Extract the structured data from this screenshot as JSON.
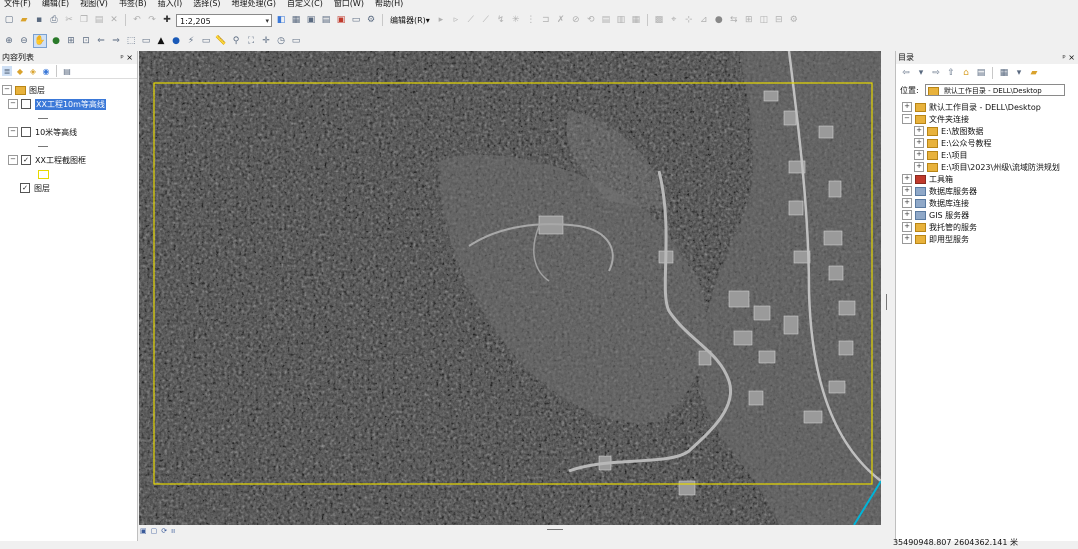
{
  "menus": [
    "文件(F)",
    "编辑(E)",
    "视图(V)",
    "书签(B)",
    "插入(I)",
    "选择(S)",
    "地理处理(G)",
    "自定义(C)",
    "窗口(W)",
    "帮助(H)"
  ],
  "toolbar": {
    "scale_value": "1:2,205",
    "editor_label": "编辑器(R)▾"
  },
  "toc": {
    "title": "内容列表",
    "pin_close": "ᵖ ×",
    "root_label": "图层",
    "layers": [
      {
        "label": "XX工程10m等高线",
        "checked": false,
        "selected": true
      },
      {
        "label": "10米等高线",
        "checked": false,
        "selected": false
      },
      {
        "label": "XX工程截图框",
        "checked": true,
        "selected": false
      }
    ],
    "sublayer_label": "图层",
    "sublayer_checked": true
  },
  "catalog": {
    "title": "目录",
    "pin_close": "ᵖ ×",
    "location_label": "位置:",
    "location_value": "默认工作目录 - DELL\\Desktop",
    "items": [
      {
        "label": "默认工作目录 - DELL\\Desktop",
        "child": false
      },
      {
        "label": "文件夹连接",
        "child": false
      },
      {
        "label": "E:\\放图数据",
        "child": true
      },
      {
        "label": "E:\\公众号教程",
        "child": true
      },
      {
        "label": "E:\\项目",
        "child": true
      },
      {
        "label": "E:\\项目\\2023\\州级\\流域防洪规划",
        "child": true
      },
      {
        "label": "工具箱",
        "child": false
      },
      {
        "label": "数据库服务器",
        "child": false
      },
      {
        "label": "数据库连接",
        "child": false
      },
      {
        "label": "GIS 服务器",
        "child": false
      },
      {
        "label": "我托管的服务",
        "child": false
      },
      {
        "label": "即用型服务",
        "child": false
      }
    ]
  },
  "status": {
    "coordinates": "35490948.807  2604362.141 米"
  },
  "colors": {
    "frame": "#e6d800",
    "selection": "#3a78d8"
  }
}
